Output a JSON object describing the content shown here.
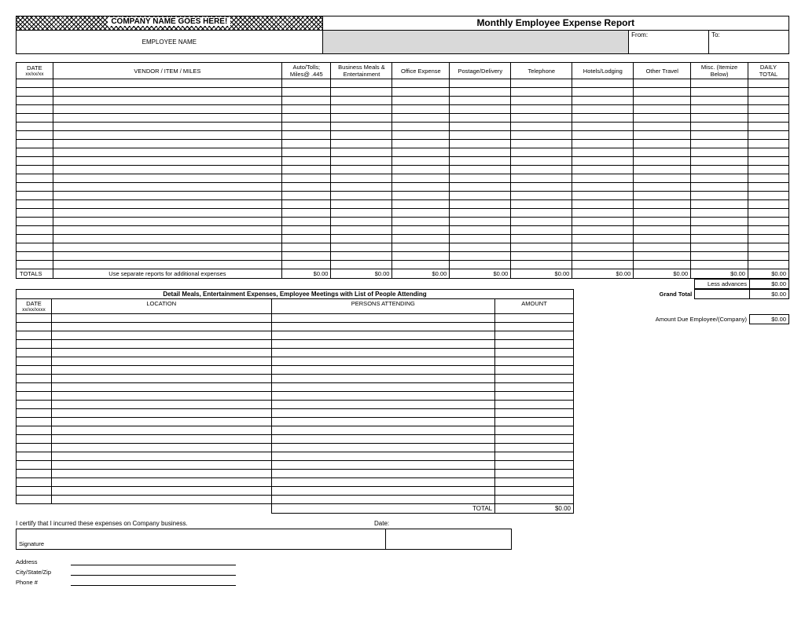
{
  "header": {
    "company_name": "COMPANY NAME GOES HERE!",
    "title": "Monthly Employee Expense Report",
    "employee_name_label": "EMPLOYEE NAME",
    "from_label": "From:",
    "to_label": "To:"
  },
  "main": {
    "columns": {
      "date": "DATE",
      "date_sub": "xx/xx/xx",
      "vendor": "VENDOR / ITEM / MILES",
      "auto": "Auto/Tolls; Miles@ .445",
      "biz": "Business Meals & Entertainment",
      "office": "Office Expense",
      "post": "Postage/Delivery",
      "tel": "Telephone",
      "hotel": "Hotels/Lodging",
      "travel": "Other Travel",
      "misc": "Misc. (Itemize Below)",
      "total": "DAILY TOTAL"
    },
    "totals_label": "TOTALS",
    "use_separate": "Use separate reports for additional expenses",
    "zero": "$0.00",
    "less_advances": "Less advances",
    "grand_total": "Grand Total",
    "amount_due": "Amount Due Employee/(Company)"
  },
  "detail": {
    "header": "Detail Meals, Entertainment Expenses, Employee Meetings with List of People Attending",
    "date": "DATE",
    "date_sub": "xx/xx/xxxx",
    "location": "LOCATION",
    "persons": "PERSONS ATTENDING",
    "amount": "AMOUNT",
    "total": "TOTAL",
    "zero": "$0.00"
  },
  "cert": {
    "text": "I certify that I incurred these expenses on Company business.",
    "date": "Date:",
    "signature": "Signature"
  },
  "addr": {
    "address": "Address",
    "csz": "City/State/Zip",
    "phone": "Phone #"
  }
}
